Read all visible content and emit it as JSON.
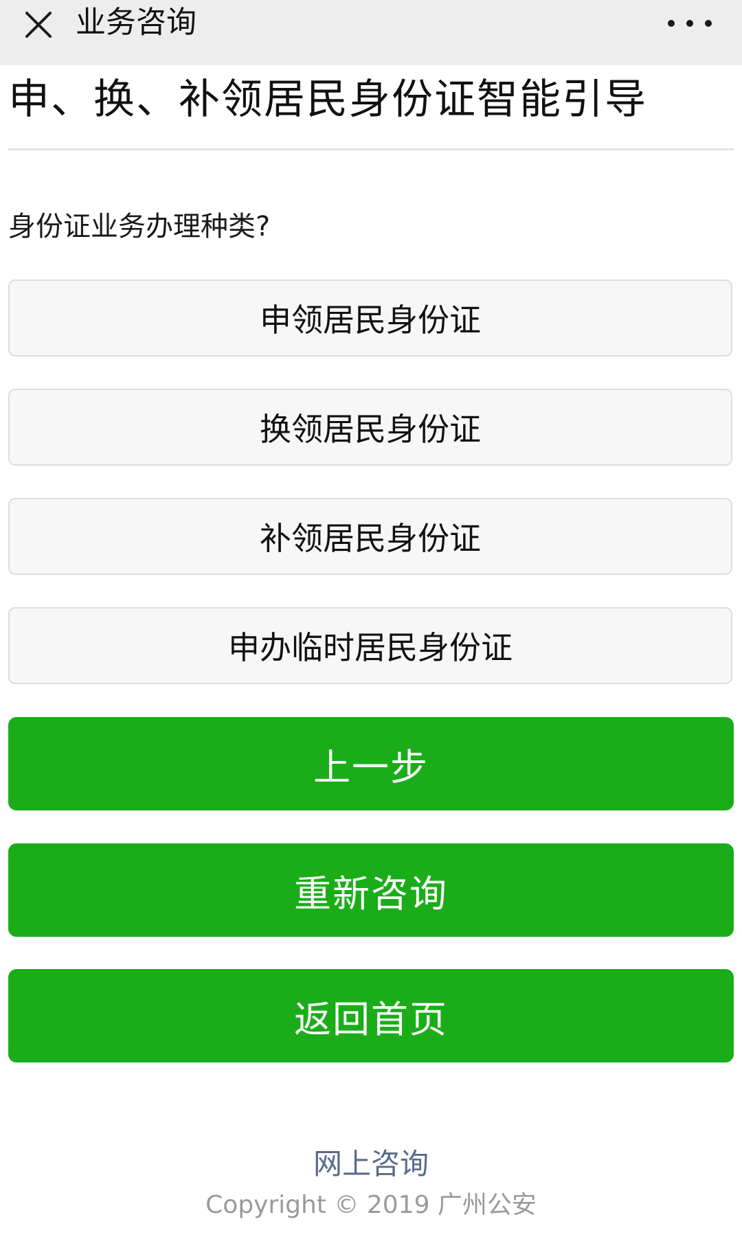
{
  "navbar": {
    "title": "业务咨询",
    "close_icon": "close-icon",
    "more_icon": "more-dots-icon"
  },
  "page": {
    "title": "申、换、补领居民身份证智能引导",
    "question": "身份证业务办理种类?"
  },
  "options": [
    {
      "label": "申领居民身份证"
    },
    {
      "label": "换领居民身份证"
    },
    {
      "label": "补领居民身份证"
    },
    {
      "label": "申办临时居民身份证"
    }
  ],
  "actions": [
    {
      "label": "上一步"
    },
    {
      "label": "重新咨询"
    },
    {
      "label": "返回首页"
    }
  ],
  "footer": {
    "link": "网上咨询",
    "copyright": "Copyright © 2019 广州公安"
  },
  "colors": {
    "accent_green": "#1aad19",
    "navbar_bg": "#ededed",
    "footer_link": "#5a6b8a"
  }
}
